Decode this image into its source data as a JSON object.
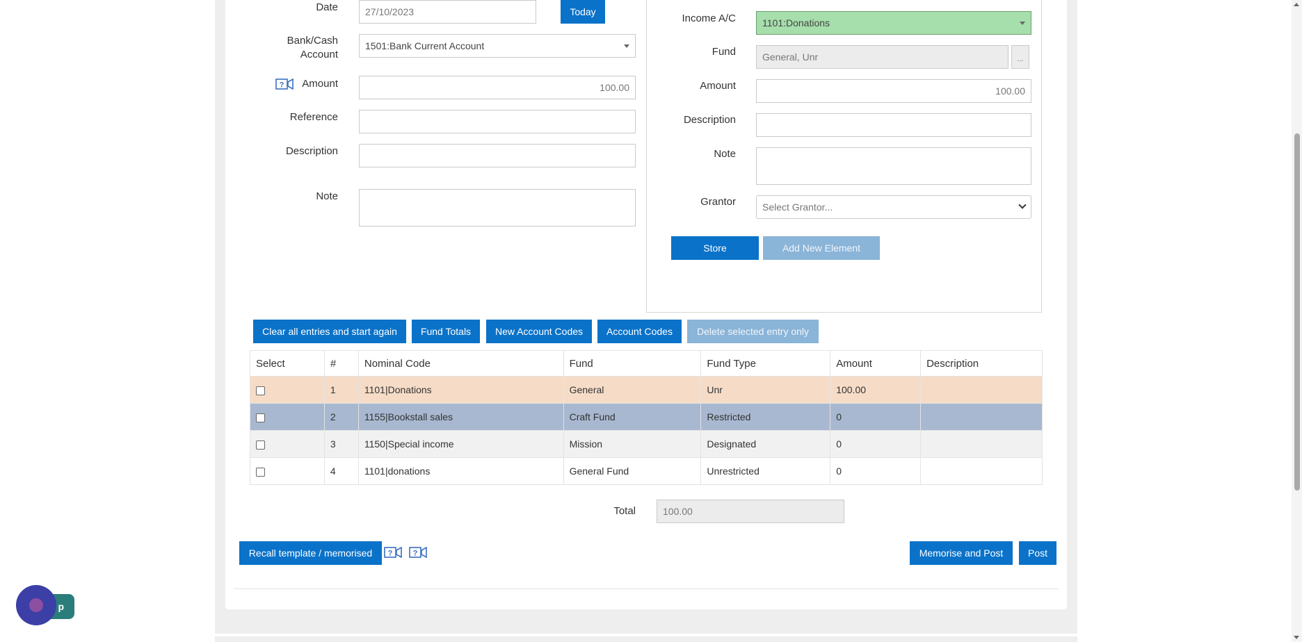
{
  "left_form": {
    "date_label": "Date",
    "date_value": "27/10/2023",
    "today_button": "Today",
    "bank_label_line1": "Bank/Cash",
    "bank_label_line2": "Account",
    "bank_value": "1501:Bank Current Account",
    "amount_label": "Amount",
    "amount_value": "100.00",
    "reference_label": "Reference",
    "reference_value": "",
    "description_label": "Description",
    "description_value": "",
    "note_label": "Note",
    "note_value": ""
  },
  "right_form": {
    "income_label": "Income A/C",
    "income_value": "1101:Donations",
    "fund_label": "Fund",
    "fund_value": "General, Unr",
    "fund_browse": "...",
    "amount_label": "Amount",
    "amount_value": "100.00",
    "description_label": "Description",
    "description_value": "",
    "note_label": "Note",
    "note_value": "",
    "grantor_label": "Grantor",
    "grantor_placeholder": "Select Grantor...",
    "store_button": "Store",
    "add_element_button": "Add New Element"
  },
  "toolbar": {
    "clear_button": "Clear all entries and start again",
    "fund_totals_button": "Fund Totals",
    "new_account_codes_button": "New Account Codes",
    "account_codes_button": "Account Codes",
    "delete_selected_button": "Delete selected entry only"
  },
  "table": {
    "headers": [
      "Select",
      "#",
      "Nominal Code",
      "Fund",
      "Fund Type",
      "Amount",
      "Description"
    ],
    "rows": [
      {
        "num": "1",
        "code": "1101|Donations",
        "fund": "General",
        "fund_type": "Unr",
        "amount": "100.00",
        "description": ""
      },
      {
        "num": "2",
        "code": "1155|Bookstall sales",
        "fund": "Craft Fund",
        "fund_type": "Restricted",
        "amount": "0",
        "description": ""
      },
      {
        "num": "3",
        "code": "1150|Special income",
        "fund": "Mission",
        "fund_type": "Designated",
        "amount": "0",
        "description": ""
      },
      {
        "num": "4",
        "code": "1101|donations",
        "fund": "General Fund",
        "fund_type": "Unrestricted",
        "amount": "0",
        "description": ""
      }
    ]
  },
  "total": {
    "label": "Total",
    "value": "100.00"
  },
  "footer": {
    "recall_button": "Recall template / memorised",
    "memorise_post_button": "Memorise and Post",
    "post_button": "Post"
  },
  "chat_widget": {
    "label": "p"
  },
  "colors": {
    "primary": "#0a72c9",
    "disabled": "#8ab4d8",
    "row_selected": "#f6dcc7",
    "row_highlight": "#a8b8d0",
    "income_green": "#a6deac"
  }
}
